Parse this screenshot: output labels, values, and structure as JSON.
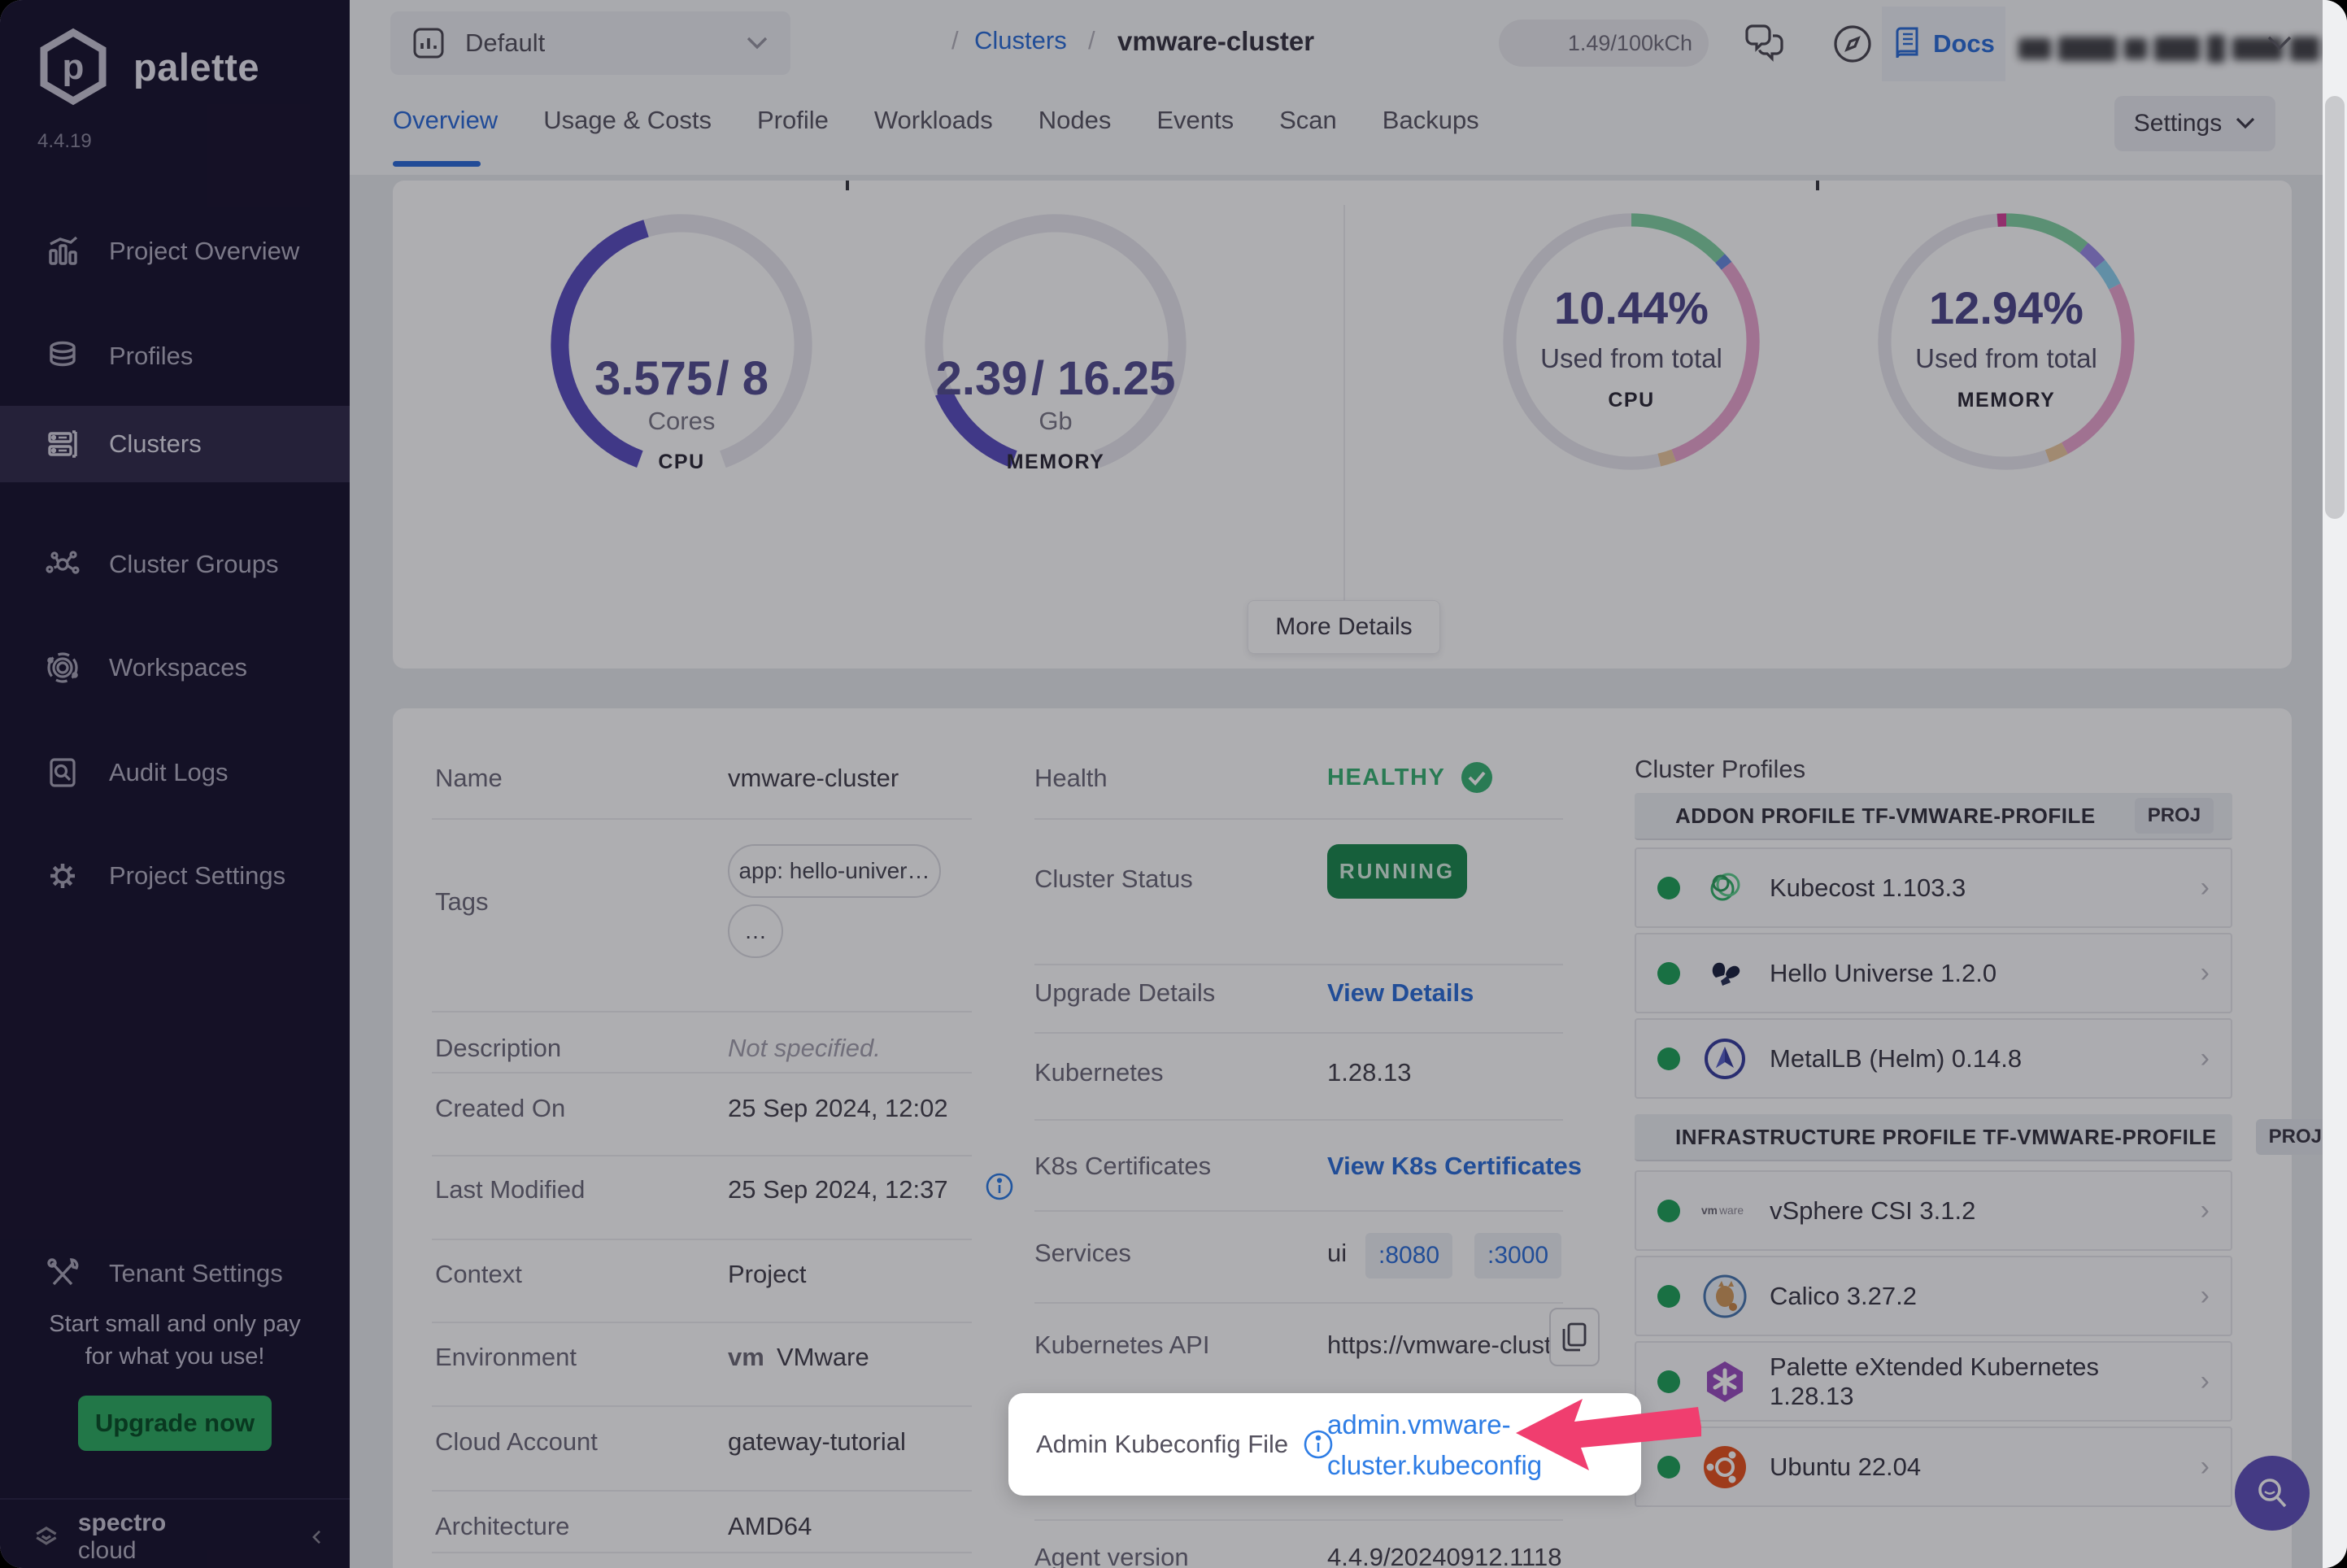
{
  "app": {
    "brand": "palette",
    "version": "4.4.19"
  },
  "sidebar": {
    "items": [
      {
        "label": "Project Overview",
        "icon": "bar-chart-icon"
      },
      {
        "label": "Profiles",
        "icon": "layers-icon"
      },
      {
        "label": "Clusters",
        "icon": "server-icon",
        "active": true
      },
      {
        "label": "Cluster Groups",
        "icon": "network-icon"
      },
      {
        "label": "Workspaces",
        "icon": "orbit-icon"
      },
      {
        "label": "Audit Logs",
        "icon": "audit-doc-icon"
      },
      {
        "label": "Project Settings",
        "icon": "gear-icon"
      }
    ],
    "tenant": {
      "label": "Tenant Settings",
      "icon": "tools-icon"
    },
    "promo": {
      "line1": "Start small and only pay",
      "line2": "for what you use!"
    },
    "upgrade_label": "Upgrade now",
    "footer": {
      "brand_bold": "spectro",
      "brand_light": " cloud"
    }
  },
  "topbar": {
    "project_selector": {
      "value": "Default"
    },
    "breadcrumb": {
      "slash1": "/",
      "section": "Clusters",
      "slash2": "/",
      "current": "vmware-cluster"
    },
    "credits": "1.49/100kCh",
    "docs_label": "Docs"
  },
  "tabs": {
    "items": [
      {
        "label": "Overview",
        "active": true
      },
      {
        "label": "Usage & Costs"
      },
      {
        "label": "Profile"
      },
      {
        "label": "Workloads"
      },
      {
        "label": "Nodes"
      },
      {
        "label": "Events"
      },
      {
        "label": "Scan"
      },
      {
        "label": "Backups"
      }
    ],
    "settings_label": "Settings"
  },
  "chart_data": [
    {
      "id": "cpu-gauge",
      "type": "gauge",
      "title": "CPU cores usage",
      "value": 3.575,
      "max": 8,
      "value_label": "3.575",
      "total_label": "/ 8",
      "unit": "Cores",
      "category": "CPU",
      "fraction": 0.447,
      "sweep_deg": 320,
      "color": "#5b4fc0",
      "track_color": "#e9e8ef"
    },
    {
      "id": "memory-gauge",
      "type": "gauge",
      "title": "Memory usage",
      "value": 2.39,
      "max": 16.25,
      "value_label": "2.39",
      "total_label": "/ 16.25",
      "unit": "Gb",
      "category": "MEMORY",
      "fraction": 0.147,
      "sweep_deg": 320,
      "color": "#5b4fc0",
      "track_color": "#e9e8ef"
    },
    {
      "id": "cpu-donut",
      "type": "donut",
      "percent_label": "10.44%",
      "caption": "Used from total",
      "category": "CPU",
      "segments": [
        {
          "name": "green",
          "color": "#83d2a4",
          "frac": 0.13
        },
        {
          "name": "blue",
          "color": "#6a8de0",
          "frac": 0.013
        },
        {
          "name": "pink",
          "color": "#eba6cf",
          "frac": 0.3
        },
        {
          "name": "tan",
          "color": "#ecc9a0",
          "frac": 0.02
        },
        {
          "name": "free",
          "color": "#e9e8ef",
          "frac": 0.537
        }
      ]
    },
    {
      "id": "memory-donut",
      "type": "donut",
      "percent_label": "12.94%",
      "caption": "Used from total",
      "category": "MEMORY",
      "segments": [
        {
          "name": "green",
          "color": "#83d2a4",
          "frac": 0.11
        },
        {
          "name": "purple",
          "color": "#9b8ce8",
          "frac": 0.03
        },
        {
          "name": "lightblue",
          "color": "#8ed1ef",
          "frac": 0.035
        },
        {
          "name": "pink",
          "color": "#eba6cf",
          "frac": 0.245
        },
        {
          "name": "tan",
          "color": "#ecc9a0",
          "frac": 0.025
        },
        {
          "name": "free",
          "color": "#e9e8ef",
          "frac": 0.543
        },
        {
          "name": "magenta",
          "color": "#d6439a",
          "frac": 0.012
        }
      ]
    }
  ],
  "usage_card": {
    "more_details_label": "More Details"
  },
  "details": {
    "left": [
      {
        "label": "Name",
        "value": "vmware-cluster"
      },
      {
        "label": "Tags",
        "tags": [
          "app: hello-univer…",
          "…"
        ]
      },
      {
        "label": "Description",
        "value": "Not specified."
      },
      {
        "label": "Created On",
        "value": "25 Sep 2024, 12:02"
      },
      {
        "label": "Last Modified",
        "value": "25 Sep 2024, 12:37"
      },
      {
        "label": "Context",
        "value": "Project"
      },
      {
        "label": "Environment",
        "value": "VMware",
        "env_mark": "vm"
      },
      {
        "label": "Cloud Account",
        "value": "gateway-tutorial"
      },
      {
        "label": "Architecture",
        "value": "AMD64"
      }
    ],
    "middle": [
      {
        "label": "Health",
        "value": "HEALTHY"
      },
      {
        "label": "Cluster Status",
        "value": "RUNNING"
      },
      {
        "label": "Upgrade Details",
        "value": "View Details"
      },
      {
        "label": "Kubernetes",
        "value": "1.28.13"
      },
      {
        "label": "K8s Certificates",
        "value": "View K8s Certificates"
      },
      {
        "label": "Services",
        "value": "ui",
        "ports": [
          ":8080",
          ":3000"
        ]
      },
      {
        "label": "Kubernetes API",
        "value": "https://vmware-clust…"
      },
      {
        "label": "Agent version",
        "value": "4.4.9/20240912.1118"
      }
    ]
  },
  "spotlight": {
    "label": "Admin Kubeconfig File",
    "link_line1": "admin.vmware-",
    "link_line2": "cluster.kubeconfig"
  },
  "cluster_profiles": {
    "title": "Cluster Profiles",
    "groups": [
      {
        "header": "ADDON PROFILE TF-VMWARE-PROFILE",
        "badge": "PROJ",
        "items": [
          {
            "name": "Kubecost 1.103.3",
            "icon": "kubecost-icon",
            "status": "green"
          },
          {
            "name": "Hello Universe 1.2.0",
            "icon": "hello-universe-icon",
            "status": "green"
          },
          {
            "name": "MetalLB (Helm) 0.14.8",
            "icon": "metallb-icon",
            "status": "green"
          }
        ]
      },
      {
        "header": "INFRASTRUCTURE PROFILE TF-VMWARE-PROFILE",
        "badge": "PROJ",
        "items": [
          {
            "name": "vSphere CSI 3.1.2",
            "icon": "vmware-icon",
            "status": "green"
          },
          {
            "name": "Calico 3.27.2",
            "icon": "calico-icon",
            "status": "green"
          },
          {
            "name": "Palette eXtended Kubernetes 1.28.13",
            "icon": "pxk-icon",
            "status": "green"
          },
          {
            "name": "Ubuntu 22.04",
            "icon": "ubuntu-icon",
            "status": "green"
          }
        ]
      }
    ]
  },
  "colors": {
    "accent_blue": "#2e6fd9",
    "gauge_purple": "#5b4fc0",
    "healthy_green": "#3bb375",
    "running_green": "#1d8a50",
    "upgrade_green": "#2fae63",
    "sidebar_bg": "#1a1530",
    "spotlight_arrow_pink": "#f03e6f",
    "status_dot_green": "#21a35b"
  }
}
